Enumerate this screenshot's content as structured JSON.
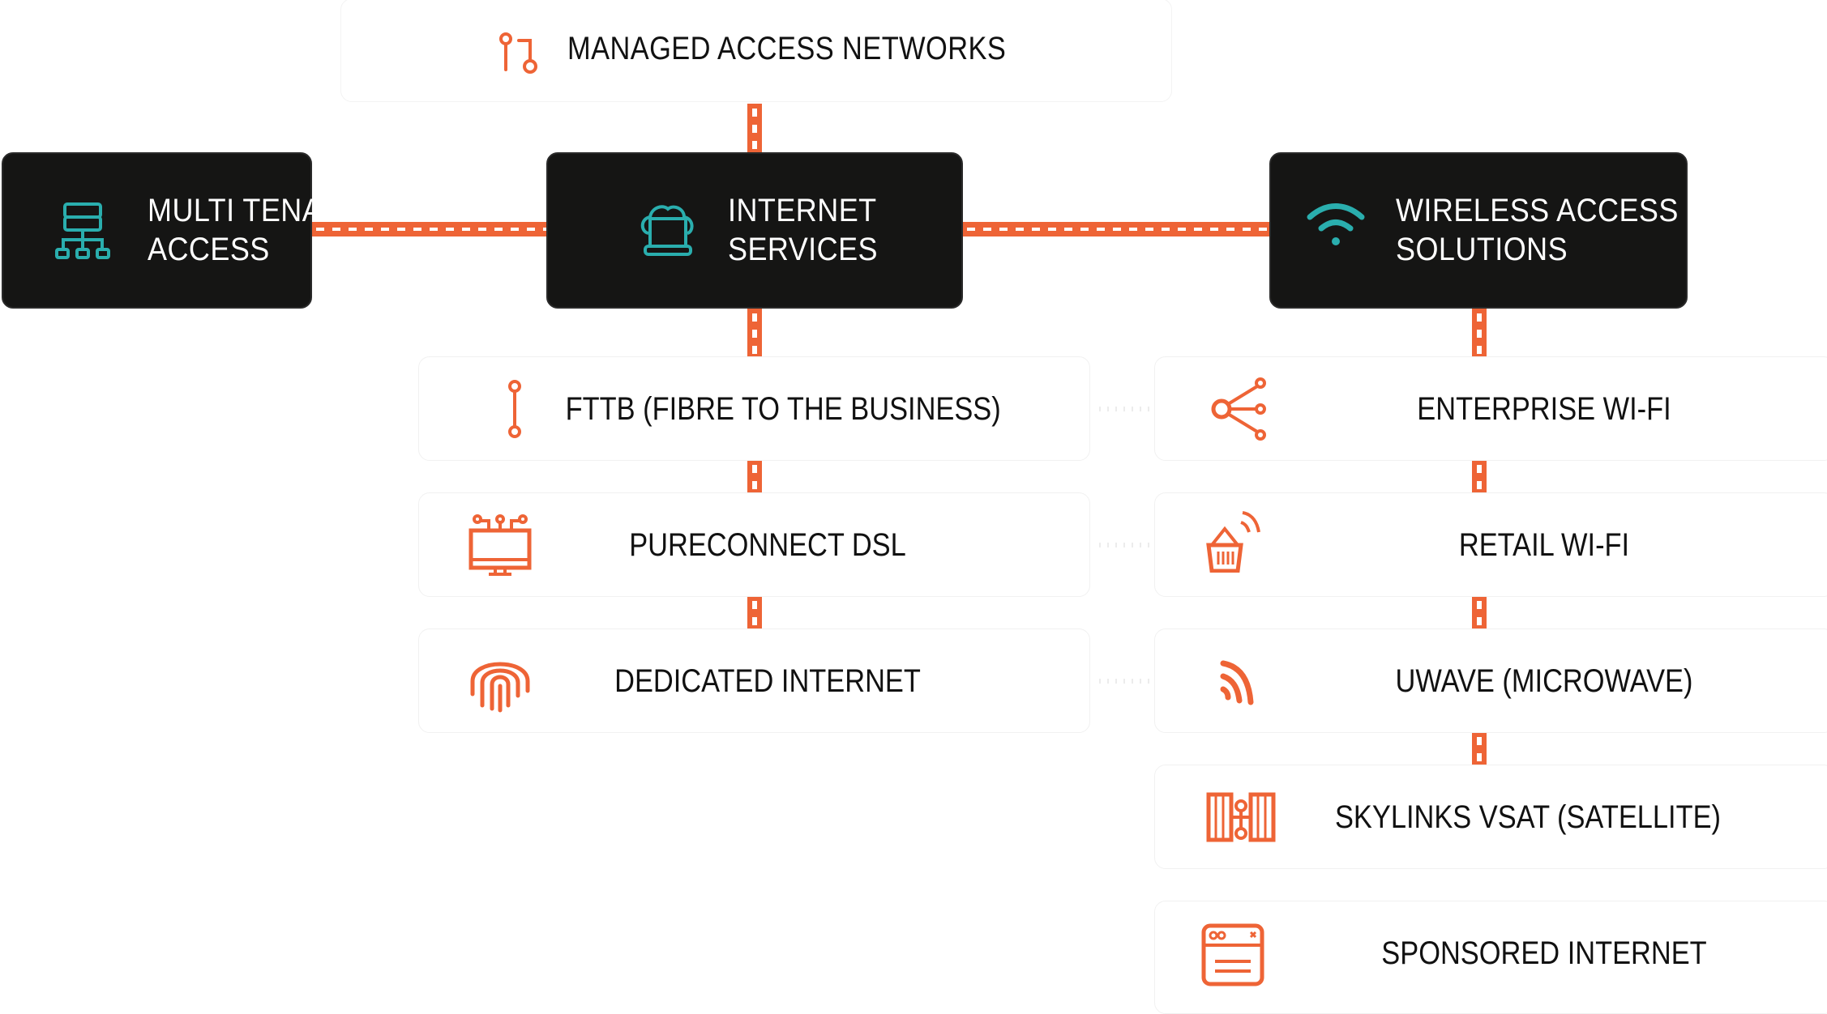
{
  "diagram": {
    "title": "MANAGED ACCESS NETWORKS",
    "title_icon": "branch-nodes-icon",
    "colors": {
      "accent": "#EE6436",
      "teal": "#2AAEAE",
      "hub_bg": "#151514",
      "text": "#111111"
    },
    "hubs": [
      {
        "id": "multi-tenant",
        "label_line1": "MULTI TENANT",
        "label_line2": "ACCESS",
        "icon": "network-hierarchy-icon"
      },
      {
        "id": "internet-services",
        "label_line1": "INTERNET",
        "label_line2": "SERVICES",
        "icon": "cloud-laptop-icon"
      },
      {
        "id": "wireless",
        "label_line1": "WIRELESS ACCESS",
        "label_line2": "SOLUTIONS",
        "icon": "wifi-icon"
      }
    ],
    "internet_services": [
      {
        "label": "FTTB (FIBRE TO THE BUSINESS)",
        "icon": "fibre-link-icon"
      },
      {
        "label": "PURECONNECT DSL",
        "icon": "connected-monitor-icon"
      },
      {
        "label": "DEDICATED INTERNET",
        "icon": "fingerprint-icon"
      }
    ],
    "wireless_services": [
      {
        "label": "ENTERPRISE WI-FI",
        "icon": "share-nodes-icon"
      },
      {
        "label": "RETAIL WI-FI",
        "icon": "basket-signal-icon"
      },
      {
        "label": "UWAVE (MICROWAVE)",
        "icon": "rss-signal-icon"
      },
      {
        "label": "SKYLINKS VSAT (SATELLITE)",
        "icon": "satellite-icon"
      },
      {
        "label": "SPONSORED INTERNET",
        "icon": "browser-window-icon"
      }
    ]
  }
}
